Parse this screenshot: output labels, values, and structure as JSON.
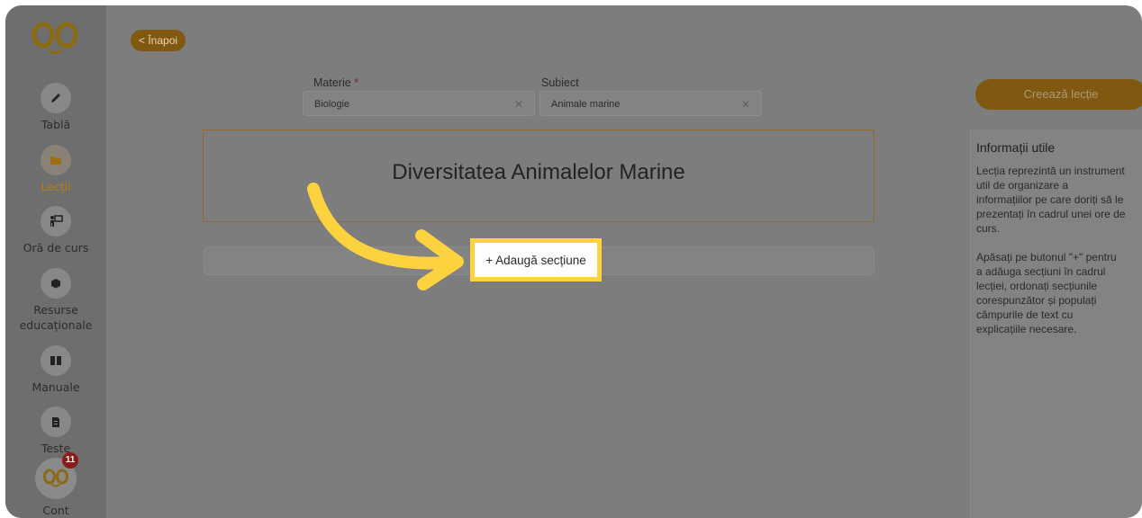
{
  "sidebar": {
    "items": [
      {
        "label": "Tablă",
        "icon": "pencil-icon"
      },
      {
        "label": "Lecții",
        "icon": "folder-icon",
        "active": true
      },
      {
        "label": "Oră de curs",
        "icon": "teacher-board-icon"
      },
      {
        "label": "Resurse educaționale",
        "icon": "box-icon"
      },
      {
        "label": "Manuale",
        "icon": "book-icon"
      },
      {
        "label": "Teste",
        "icon": "document-icon"
      }
    ],
    "account": {
      "label": "Cont",
      "badge": "11"
    }
  },
  "header": {
    "back_label": "< Înapoi"
  },
  "form": {
    "subject_label": "Materie",
    "subject_required": "*",
    "subject_value": "Biologie",
    "topic_label": "Subiect",
    "topic_value": "Animale marine"
  },
  "lesson": {
    "title": "Diversitatea Animalelor Marine"
  },
  "add_section_label": "+ Adaugă secțiune",
  "create_button_label": "Creează lecție",
  "info": {
    "title": "Informații utile",
    "paragraph1": "Lecția reprezintă un instrument\nutil de organizare a\ninformațiilor pe care doriți să le\nprezentați în cadrul unei ore de\ncurs.",
    "paragraph2": "Apăsați pe butonul \"+\" pentru\na adăuga secțiuni în cadrul\nlecției, ordonați secțiunile\ncorespunzător și populați\ncâmpurile de text cu\nexplicațiile necesare."
  },
  "colors": {
    "accent": "#b97d10",
    "highlight": "#fcd23f",
    "overlay": "#7d7d7d"
  }
}
